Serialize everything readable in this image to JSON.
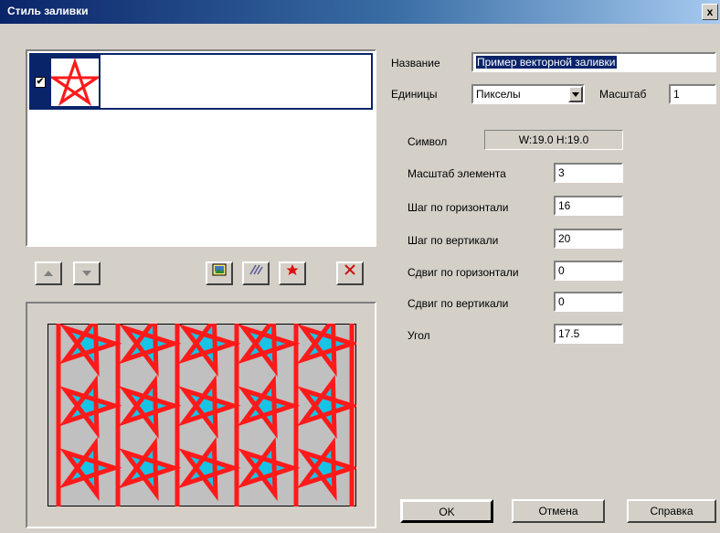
{
  "window": {
    "title": "Стиль заливки",
    "close_glyph": "x"
  },
  "list": {
    "items": [
      {
        "checked": true,
        "check_glyph": "✔"
      }
    ]
  },
  "form": {
    "name_label": "Название",
    "name_value": "Пример векторной заливки",
    "units_label": "Единицы",
    "units_value": "Пикселы",
    "scale_label": "Масштаб",
    "scale_value": "1",
    "symbol_label": "Символ",
    "symbol_size": "W:19.0  H:19.0",
    "element_scale_label": "Масштаб элемента",
    "element_scale_value": "3",
    "h_step_label": "Шаг по горизонтали",
    "h_step_value": "16",
    "v_step_label": "Шаг по вертикали",
    "v_step_value": "20",
    "h_shift_label": "Сдвиг по горизонтали",
    "h_shift_value": "0",
    "v_shift_label": "Сдвиг по вертикали",
    "v_shift_value": "0",
    "angle_label": "Угол",
    "angle_value": "17.5"
  },
  "buttons": {
    "ok": "OK",
    "cancel": "Отмена",
    "help": "Справка"
  },
  "colors": {
    "star_stroke": "#ff1a1a",
    "star_fill": "#17c4e6",
    "preview_bg": "#c0c0c0",
    "selection": "#0a246a"
  }
}
